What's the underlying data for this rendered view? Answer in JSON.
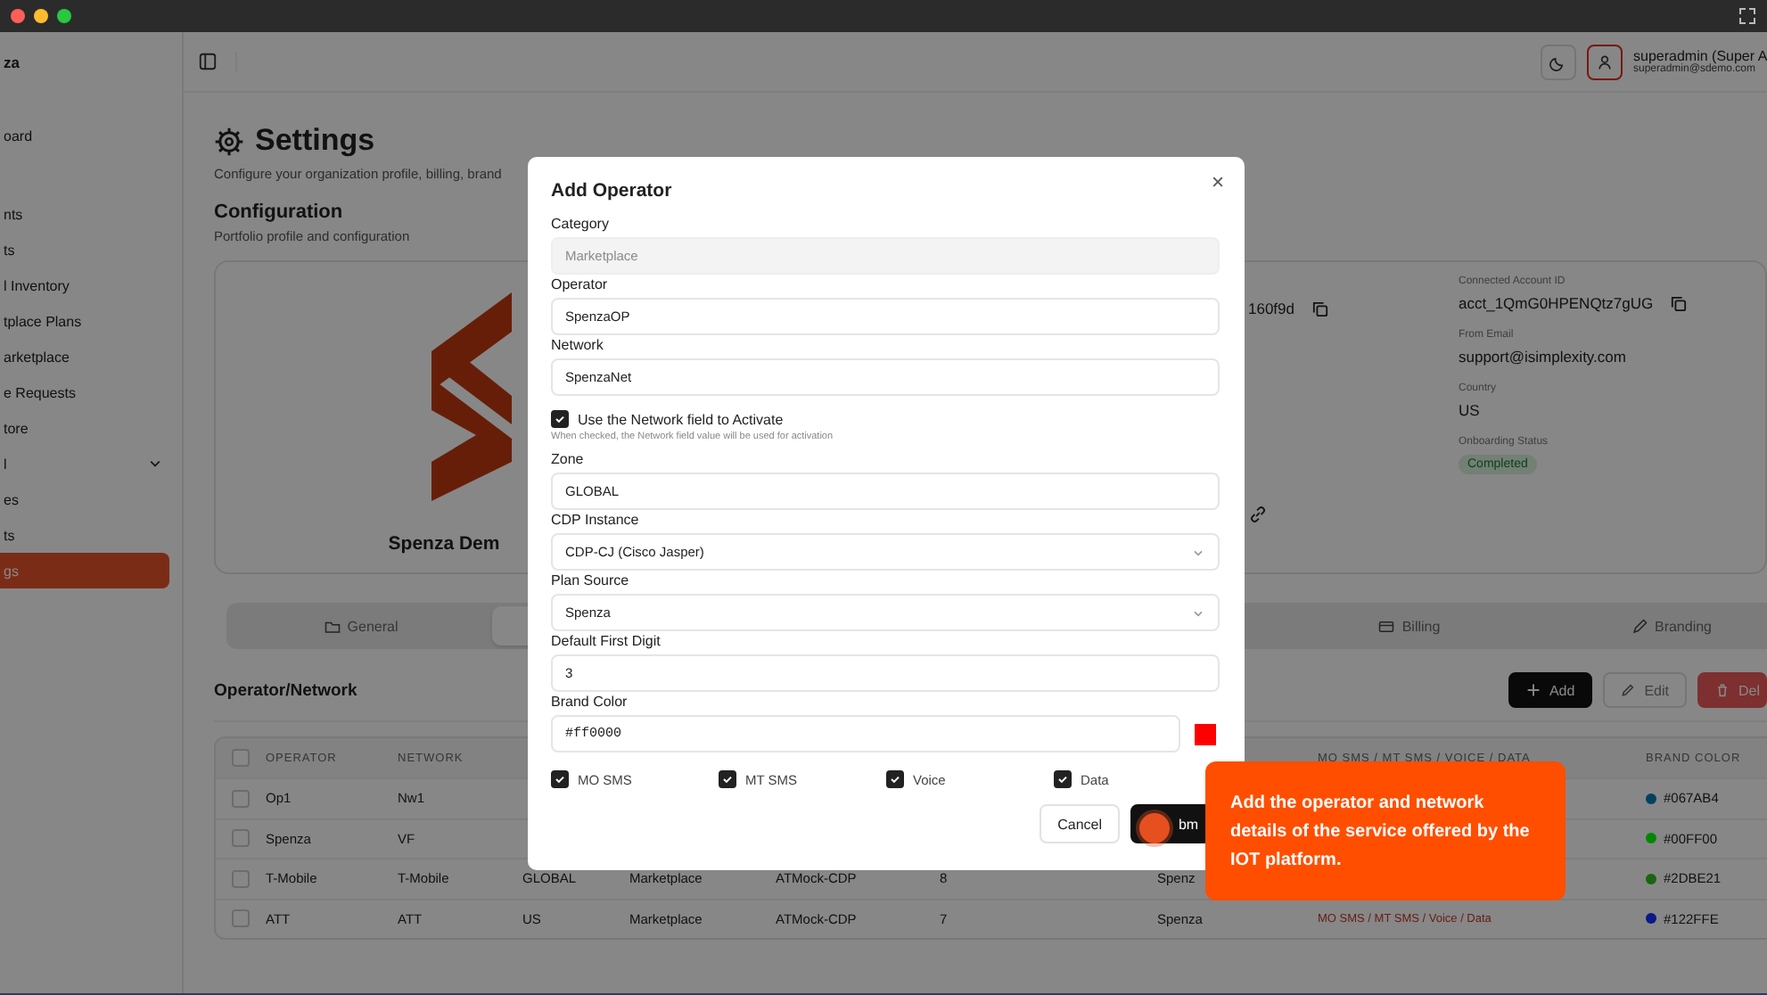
{
  "sidebar": {
    "brand": "za",
    "sections": [
      {
        "items": [
          {
            "label": "oard",
            "kind": "link",
            "selected": false
          }
        ]
      },
      {
        "items": [
          {
            "label": "nts",
            "kind": "link",
            "selected": false
          },
          {
            "label": "ts",
            "kind": "link",
            "selected": false
          },
          {
            "label": "l Inventory",
            "kind": "link",
            "selected": false
          },
          {
            "label": "tplace Plans",
            "kind": "link",
            "selected": false
          },
          {
            "label": "arketplace",
            "kind": "link",
            "selected": false
          },
          {
            "label": "e Requests",
            "kind": "link",
            "selected": false
          },
          {
            "label": "tore",
            "kind": "link",
            "selected": false
          },
          {
            "label": "l",
            "kind": "group",
            "children": [
              {
                "label": "es",
                "kind": "link",
                "selected": false
              },
              {
                "label": "ts",
                "kind": "link",
                "selected": false
              },
              {
                "label": "gs",
                "kind": "link",
                "selected": true
              }
            ]
          }
        ]
      }
    ]
  },
  "header": {
    "user_name": "superadmin (Super A",
    "user_email": "superadmin@sdemo.com"
  },
  "page": {
    "title": "Settings",
    "subtitle": "Configure your organization profile, billing, brand"
  },
  "section": {
    "title": "Configuration",
    "subtitle": "Portfolio profile and configuration"
  },
  "profile_card": {
    "name": "Spenza Dem",
    "id_fragment": "160f9d",
    "fields": [
      {
        "label": "Connected Account ID",
        "value": "acct_1QmG0HPENQtz7gUG",
        "kind": "copy"
      },
      {
        "label": "From Email",
        "value": "support@isimplexity.com",
        "kind": "text"
      },
      {
        "label": "Country",
        "value": "US",
        "kind": "text"
      },
      {
        "label": "Onboarding Status",
        "value": "Completed",
        "kind": "badge"
      }
    ]
  },
  "tabs": [
    {
      "label": "General",
      "kind": "general",
      "selected": false
    },
    {
      "kind": "hidden",
      "selected": true
    },
    {
      "label": "Billing",
      "kind": "billing",
      "selected": false
    },
    {
      "label": "Branding",
      "kind": "branding",
      "selected": false
    }
  ],
  "operator_table": {
    "title": "Operator/Network",
    "actions": [
      {
        "label": "Add",
        "kind": "primary"
      },
      {
        "label": "Edit",
        "kind": "secondary"
      },
      {
        "label": "Del",
        "kind": "danger"
      }
    ],
    "select_all": false,
    "columns": {
      "operator": "OPERATOR",
      "network": "NETWORK",
      "column_8": "MO SMS / MT SMS / VOICE / DATA",
      "brand_color": "BRAND COLOR"
    },
    "rows": [
      {
        "selected": false,
        "operator": "Op1",
        "network": "Nw1",
        "brand_color": "#067AB4",
        "color": "#03415f"
      },
      {
        "selected": false,
        "operator": "Spenza",
        "network": "VF",
        "brand_color": "#00FF00",
        "color": "#008700"
      },
      {
        "selected": false,
        "operator": "T-Mobile",
        "network": "T-Mobile",
        "column_3": "GLOBAL",
        "column_4": "Marketplace",
        "column_5": "ATMock-CDP",
        "column_6": "8",
        "column_7": "Spenz",
        "brand_color": "#2DBE21",
        "color": "#186512"
      },
      {
        "selected": false,
        "operator": "ATT",
        "network": "ATT",
        "column_3": "US",
        "column_4": "Marketplace",
        "column_5": "ATMock-CDP",
        "column_6": "7",
        "column_7": "Spenza",
        "services": "MO SMS / MT SMS / Voice / Data",
        "brand_color": "#122FFE",
        "color": "#0a1987"
      }
    ]
  },
  "dialog": {
    "title": "Add Operator",
    "fields": [
      {
        "kind": "text",
        "label": "Category",
        "value": "Marketplace",
        "disabled": true
      },
      {
        "kind": "text",
        "label": "Operator",
        "value": "SpenzaOP",
        "disabled": false
      },
      {
        "kind": "text",
        "label": "Network",
        "value": "SpenzaNet",
        "disabled": false
      },
      {
        "kind": "checkbox",
        "label": "Use the Network field to Activate",
        "checked": true,
        "help": "When checked, the Network field value will be used for activation"
      },
      {
        "kind": "text",
        "label": "Zone",
        "value": "GLOBAL",
        "disabled": false
      },
      {
        "kind": "select",
        "label": "CDP Instance",
        "value": "CDP-CJ (Cisco Jasper)",
        "disabled": false
      },
      {
        "kind": "select",
        "label": "Plan Source",
        "value": "Spenza",
        "disabled": false
      },
      {
        "kind": "text",
        "label": "Default First Digit",
        "value": "3",
        "disabled": false
      },
      {
        "kind": "color",
        "label": "Brand Color",
        "value": "#ff0000",
        "color": "#ff0000",
        "disabled": false
      }
    ],
    "services": [
      {
        "label": "MO SMS",
        "checked": true
      },
      {
        "label": "MT SMS",
        "checked": true
      },
      {
        "label": "Voice",
        "checked": true
      },
      {
        "label": "Data",
        "checked": true
      }
    ],
    "buttons": [
      {
        "label": "Cancel",
        "kind": "secondary"
      },
      {
        "label": "bm",
        "kind": "primary"
      }
    ]
  },
  "tour_tip": {
    "text": "Add the operator and network details of the service offered by the IOT platform."
  }
}
